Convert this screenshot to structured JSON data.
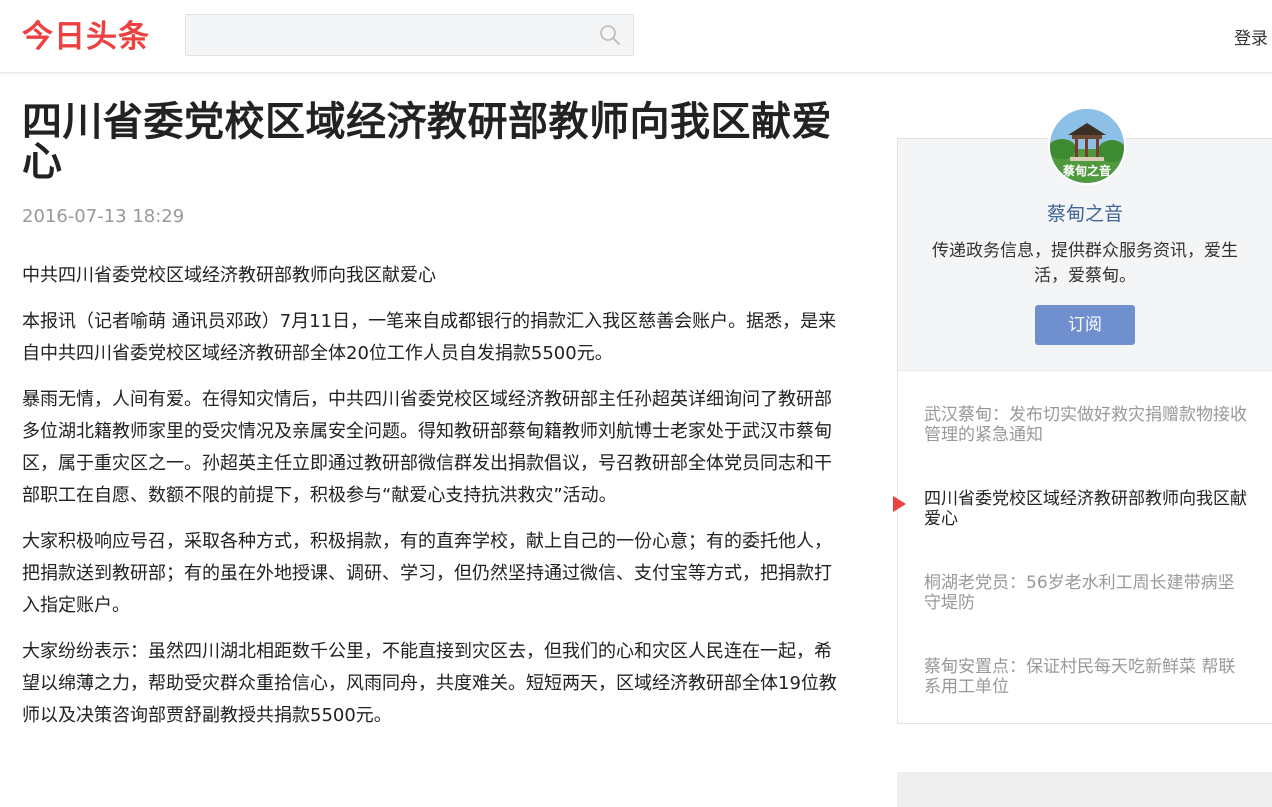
{
  "header": {
    "logo": "今日头条",
    "search_placeholder": "",
    "login": "登录",
    "brand_color": "#ed4040"
  },
  "article": {
    "title": "四川省委党校区域经济教研部教师向我区献爱心",
    "date": "2016-07-13 18:29",
    "paragraphs": [
      "中共四川省委党校区域经济教研部教师向我区献爱心",
      "本报讯（记者喻萌 通讯员邓政）7月11日，一笔来自成都银行的捐款汇入我区慈善会账户。据悉，是来自中共四川省委党校区域经济教研部全体20位工作人员自发捐款5500元。",
      "暴雨无情，人间有爱。在得知灾情后，中共四川省委党校区域经济教研部主任孙超英详细询问了教研部多位湖北籍教师家里的受灾情况及亲属安全问题。得知教研部蔡甸籍教师刘航博士老家处于武汉市蔡甸区，属于重灾区之一。孙超英主任立即通过教研部微信群发出捐款倡议，号召教研部全体党员同志和干部职工在自愿、数额不限的前提下，积极参与“献爱心支持抗洪救灾”活动。",
      "大家积极响应号召，采取各种方式，积极捐款，有的直奔学校，献上自己的一份心意；有的委托他人，把捐款送到教研部；有的虽在外地授课、调研、学习，但仍然坚持通过微信、支付宝等方式，把捐款打入指定账户。",
      "大家纷纷表示：虽然四川湖北相距数千公里，不能直接到灾区去，但我们的心和灾区人民连在一起，希望以绵薄之力，帮助受灾群众重拾信心，风雨同舟，共度难关。短短两天，区域经济教研部全体19位教师以及决策咨询部贾舒副教授共捐款5500元。"
    ]
  },
  "sidebar": {
    "avatar_caption": "蔡甸之音",
    "name": "蔡甸之音",
    "description": "传递政务信息，提供群众服务资讯，爱生活，爱蔡甸。",
    "subscribe": "订阅",
    "subscribe_color": "#6f8fce",
    "related": [
      "武汉蔡甸：发布切实做好救灾捐赠款物接收管理的紧急通知",
      "四川省委党校区域经济教研部教师向我区献爱心",
      "桐湖老党员：56岁老水利工周长建带病坚守堤防",
      "蔡甸安置点：保证村民每天吃新鲜菜 帮联系用工单位"
    ],
    "current_index": 1
  }
}
